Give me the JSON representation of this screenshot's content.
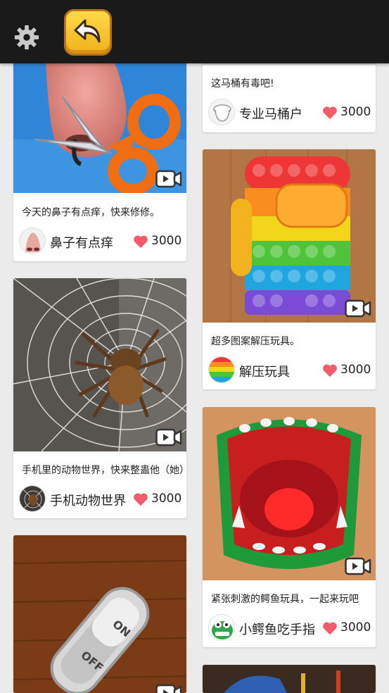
{
  "header": {
    "settings_icon": "gear-icon",
    "back_icon": "undo-arrow-icon",
    "back_color": "#f5c228"
  },
  "cards": [
    {
      "id": "toilet",
      "desc": "这马桶有毒吧!",
      "author": "专业马桶户",
      "likes": "3000"
    },
    {
      "id": "nose",
      "desc": "今天的鼻子有点痒，快来修修。",
      "author": "鼻子有点痒",
      "likes": "3000"
    },
    {
      "id": "popit",
      "desc": "超多图案解压玩具。",
      "author": "解压玩具",
      "likes": "3000"
    },
    {
      "id": "spider",
      "desc": "手机里的动物世界，快来整蛊他（她）",
      "author": "手机动物世界",
      "likes": "3000"
    },
    {
      "id": "croc",
      "desc": "紧张刺激的鳄鱼玩具，一起来玩吧",
      "author": "小鳄鱼吃手指",
      "likes": "3000"
    },
    {
      "id": "switch",
      "switch_on": "ON",
      "switch_off": "OFF"
    }
  ],
  "colors": {
    "heart": "#f25c6a",
    "background": "#ebebeb",
    "topbar": "#1a1a1a"
  }
}
